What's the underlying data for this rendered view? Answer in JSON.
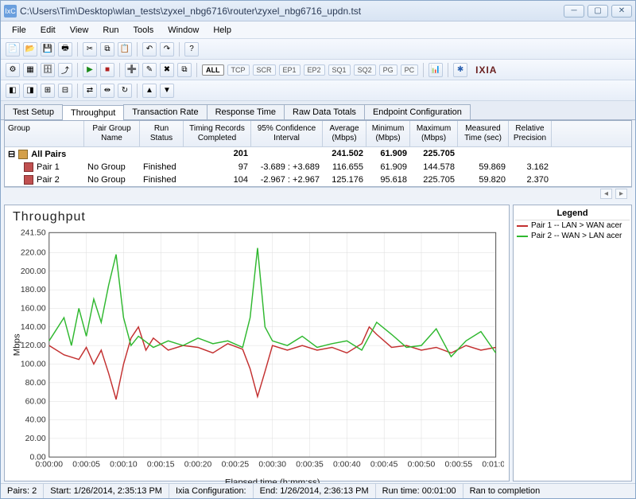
{
  "window": {
    "title": "C:\\Users\\Tim\\Desktop\\wlan_tests\\zyxel_nbg6716\\router\\zyxel_nbg6716_updn.tst",
    "icon_label": "IxC"
  },
  "menu": [
    "File",
    "Edit",
    "View",
    "Run",
    "Tools",
    "Window",
    "Help"
  ],
  "filter_buttons": [
    "ALL",
    "TCP",
    "SCR",
    "EP1",
    "EP2",
    "SQ1",
    "SQ2",
    "PG",
    "PC"
  ],
  "brand": "IXIA",
  "tabs": [
    "Test Setup",
    "Throughput",
    "Transaction Rate",
    "Response Time",
    "Raw Data Totals",
    "Endpoint Configuration"
  ],
  "active_tab": 1,
  "grid": {
    "headers": {
      "group": "Group",
      "pgn": "Pair Group Name",
      "run": "Run Status",
      "tr": "Timing Records Completed",
      "ci": "95% Confidence Interval",
      "avg": "Average (Mbps)",
      "min": "Minimum (Mbps)",
      "max": "Maximum (Mbps)",
      "mt": "Measured Time (sec)",
      "rp": "Relative Precision"
    },
    "summary": {
      "label": "All Pairs",
      "tr": "201",
      "avg": "241.502",
      "min": "61.909",
      "max": "225.705"
    },
    "rows": [
      {
        "label": "Pair 1",
        "pgn": "No Group",
        "run": "Finished",
        "tr": "97",
        "ci": "-3.689 : +3.689",
        "avg": "116.655",
        "min": "61.909",
        "max": "144.578",
        "mt": "59.869",
        "rp": "3.162"
      },
      {
        "label": "Pair 2",
        "pgn": "No Group",
        "run": "Finished",
        "tr": "104",
        "ci": "-2.967 : +2.967",
        "avg": "125.176",
        "min": "95.618",
        "max": "225.705",
        "mt": "59.820",
        "rp": "2.370"
      }
    ]
  },
  "chart_data": {
    "type": "line",
    "title": "Throughput",
    "xlabel": "Elapsed time (h:mm:ss)",
    "ylabel": "Mbps",
    "ylim": [
      0,
      241.5
    ],
    "y_ticks": [
      0,
      20,
      40,
      60,
      80,
      100,
      120,
      140,
      160,
      180,
      200,
      220,
      241.5
    ],
    "x_ticks": [
      "0:00:00",
      "0:00:05",
      "0:00:10",
      "0:00:15",
      "0:00:20",
      "0:00:25",
      "0:00:30",
      "0:00:35",
      "0:00:40",
      "0:00:45",
      "0:00:50",
      "0:00:55",
      "0:01:00"
    ],
    "series": [
      {
        "name": "Pair 1 -- LAN > WAN acer",
        "color": "#c33030",
        "x": [
          0,
          2,
          4,
          5,
          6,
          7,
          8,
          9,
          10,
          11,
          12,
          13,
          14,
          16,
          18,
          20,
          22,
          24,
          26,
          27,
          28,
          29,
          30,
          32,
          34,
          36,
          38,
          40,
          42,
          43,
          44,
          46,
          48,
          50,
          52,
          54,
          56,
          58,
          60
        ],
        "y": [
          120,
          110,
          105,
          118,
          100,
          115,
          90,
          62,
          100,
          128,
          140,
          115,
          128,
          115,
          120,
          118,
          112,
          122,
          116,
          95,
          65,
          92,
          120,
          115,
          120,
          115,
          118,
          112,
          122,
          140,
          132,
          118,
          120,
          115,
          118,
          112,
          120,
          115,
          118
        ]
      },
      {
        "name": "Pair 2 -- WAN > LAN acer",
        "color": "#2fb82f",
        "x": [
          0,
          2,
          3,
          4,
          5,
          6,
          7,
          8,
          9,
          10,
          11,
          12,
          14,
          16,
          18,
          20,
          22,
          24,
          26,
          27,
          28,
          29,
          30,
          32,
          34,
          36,
          38,
          40,
          42,
          44,
          46,
          48,
          50,
          52,
          54,
          56,
          58,
          60
        ],
        "y": [
          125,
          150,
          120,
          160,
          130,
          170,
          145,
          185,
          218,
          150,
          120,
          130,
          118,
          125,
          120,
          128,
          122,
          125,
          118,
          150,
          225,
          140,
          125,
          120,
          130,
          118,
          122,
          125,
          115,
          145,
          132,
          118,
          120,
          138,
          108,
          125,
          135,
          112
        ]
      }
    ]
  },
  "legend": {
    "title": "Legend"
  },
  "status": {
    "pairs": "Pairs: 2",
    "start": "Start: 1/26/2014, 2:35:13 PM",
    "ixia_cfg": "Ixia Configuration:",
    "end": "End: 1/26/2014, 2:36:13 PM",
    "runtime": "Run time: 00:01:00",
    "completion": "Ran to completion"
  }
}
